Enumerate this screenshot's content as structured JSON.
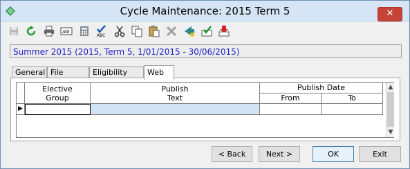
{
  "window": {
    "title": "Cycle Maintenance: 2015 Term 5",
    "close_glyph": "✕"
  },
  "toolbar": {
    "items": [
      {
        "icon": "save-icon"
      },
      {
        "icon": "refresh-icon"
      },
      {
        "icon": "print-icon"
      },
      {
        "icon": "field-label-icon"
      },
      {
        "icon": "calculator-icon"
      },
      {
        "icon": "spellcheck-icon"
      },
      {
        "icon": "cut-icon"
      },
      {
        "icon": "copy-icon"
      },
      {
        "icon": "paste-icon"
      },
      {
        "icon": "delete-icon"
      },
      {
        "icon": "navigate-icon"
      },
      {
        "icon": "approve-icon"
      },
      {
        "icon": "import-icon"
      }
    ]
  },
  "context": {
    "text": "Summer 2015 (2015, Term 5, 1/01/2015 - 30/06/2015)"
  },
  "tabs": [
    {
      "label": "General",
      "active": false
    },
    {
      "label": "File Types",
      "active": false
    },
    {
      "label": "Eligibility Rules",
      "active": false
    },
    {
      "label": "Web",
      "active": true
    }
  ],
  "grid": {
    "col_elective_group": "Elective\nGroup",
    "col_publish_text": "Publish\nText",
    "col_publish_date": "Publish Date",
    "col_from": "From",
    "col_to": "To",
    "row_indicator": "▶"
  },
  "buttons": {
    "back": "< Back",
    "next": "Next >",
    "ok": "OK",
    "exit": "Exit"
  },
  "colors": {
    "context_text": "#2020c8",
    "title_bar": "#d6e5f5",
    "close": "#c64337",
    "selected_cell": "#d3e2f2"
  }
}
